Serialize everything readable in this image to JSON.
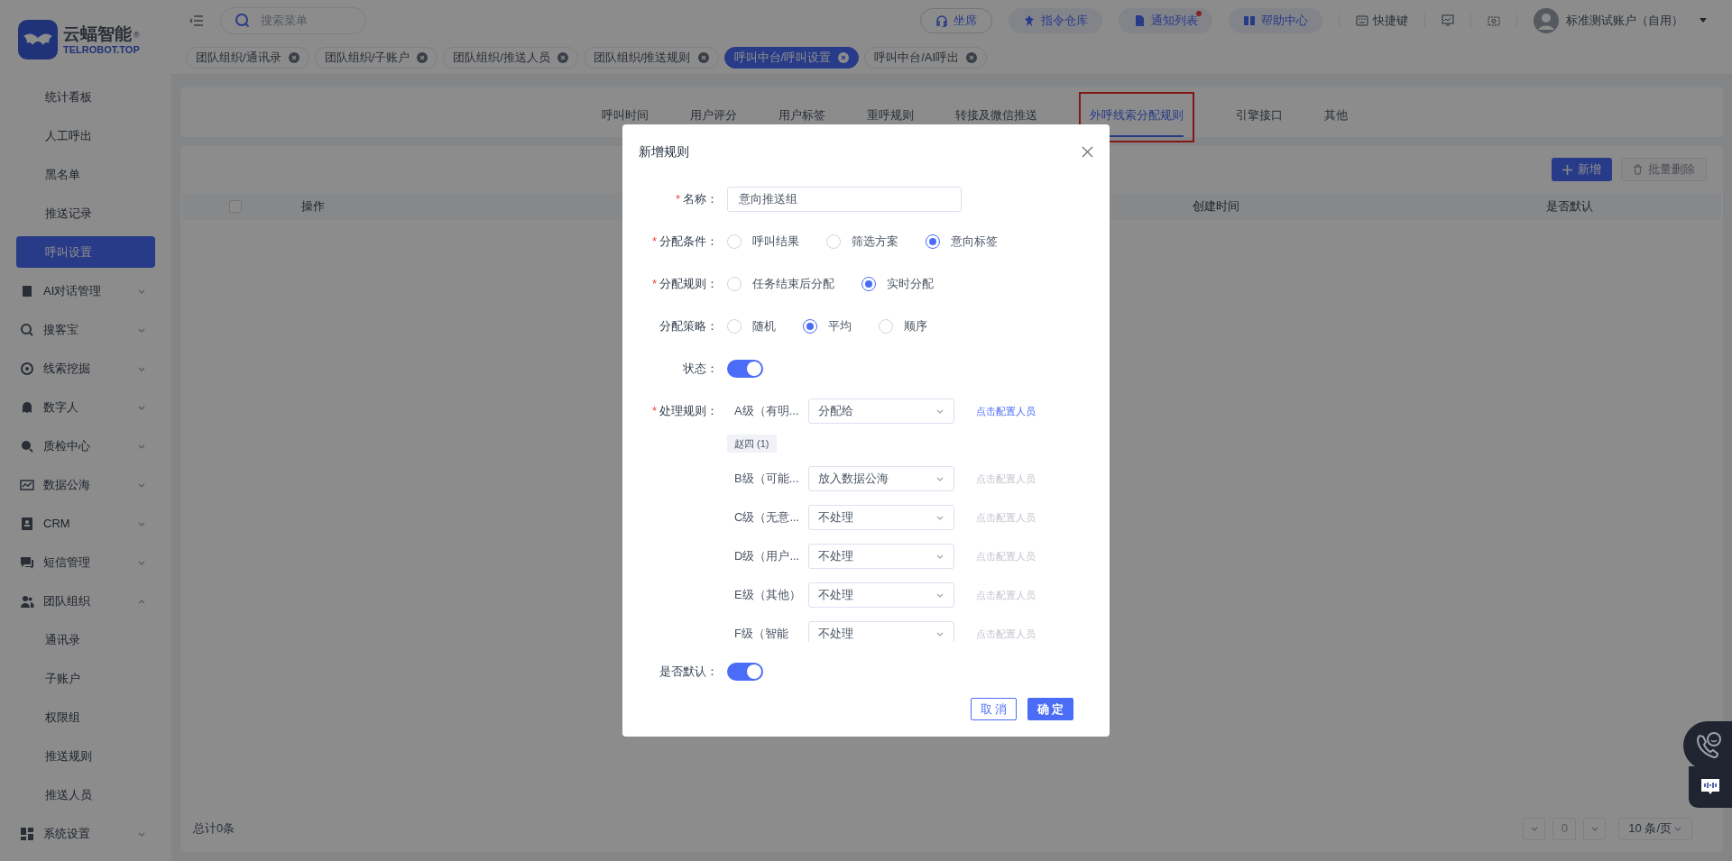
{
  "sidebar": {
    "logo": {
      "name": "云蝠智能",
      "sub": "TELROBOT.TOP",
      "mark": "®"
    },
    "items": [
      {
        "kind": "link",
        "label": "统计看板",
        "selected": false
      },
      {
        "kind": "link",
        "label": "人工呼出",
        "selected": false
      },
      {
        "kind": "link",
        "label": "黑名单",
        "selected": false
      },
      {
        "kind": "link",
        "label": "推送记录",
        "selected": false
      },
      {
        "kind": "link",
        "label": "呼叫设置",
        "selected": true
      },
      {
        "kind": "group",
        "label": "AI对话管理",
        "expanded": false
      },
      {
        "kind": "group",
        "label": "搜客宝",
        "expanded": false
      },
      {
        "kind": "group",
        "label": "线索挖掘",
        "expanded": false
      },
      {
        "kind": "group",
        "label": "数字人",
        "expanded": false
      },
      {
        "kind": "group",
        "label": "质检中心",
        "expanded": false
      },
      {
        "kind": "group",
        "label": "数据公海",
        "expanded": false
      },
      {
        "kind": "group",
        "label": "CRM",
        "expanded": false
      },
      {
        "kind": "group",
        "label": "短信管理",
        "expanded": false
      },
      {
        "kind": "group",
        "label": "团队组织",
        "expanded": true,
        "children": [
          {
            "label": "通讯录",
            "selected": false
          },
          {
            "label": "子账户",
            "selected": false
          },
          {
            "label": "权限组",
            "selected": false
          },
          {
            "label": "推送规则",
            "selected": false
          },
          {
            "label": "推送人员",
            "selected": false
          }
        ]
      },
      {
        "kind": "group",
        "label": "系统设置",
        "expanded": false
      }
    ]
  },
  "header": {
    "search": {
      "placeholder": "搜索菜单"
    },
    "buttons": [
      {
        "kind": "outline",
        "label": "坐席",
        "dot": false
      },
      {
        "kind": "pill",
        "label": "指令仓库",
        "dot": false
      },
      {
        "kind": "pill",
        "label": "通知列表",
        "dot": true
      },
      {
        "kind": "pill",
        "label": "帮助中心",
        "dot": false
      }
    ],
    "shortcut": "快捷键",
    "user": "标准测试账户（自用）"
  },
  "tags": [
    {
      "label": "团队组织/通讯录",
      "selected": false
    },
    {
      "label": "团队组织/子账户",
      "selected": false
    },
    {
      "label": "团队组织/推送人员",
      "selected": false
    },
    {
      "label": "团队组织/推送规则",
      "selected": false
    },
    {
      "label": "呼叫中台/呼叫设置",
      "selected": true
    },
    {
      "label": "呼叫中台/AI呼出",
      "selected": false
    }
  ],
  "tabs": [
    {
      "label": "呼叫时间",
      "selected": false,
      "annotated": false
    },
    {
      "label": "用户评分",
      "selected": false,
      "annotated": false
    },
    {
      "label": "用户标签",
      "selected": false,
      "annotated": false
    },
    {
      "label": "重呼规则",
      "selected": false,
      "annotated": false
    },
    {
      "label": "转接及微信推送",
      "selected": false,
      "annotated": false
    },
    {
      "label": "外呼线索分配规则",
      "selected": true,
      "annotated": true
    },
    {
      "label": "引擎接口",
      "selected": false,
      "annotated": false
    },
    {
      "label": "其他",
      "selected": false,
      "annotated": false
    }
  ],
  "toolbar": [
    {
      "label": "新增",
      "disabled": false
    },
    {
      "label": "批量删除",
      "disabled": true
    }
  ],
  "table": {
    "select_all": {
      "checked": false
    },
    "columns": [
      "操作",
      "创建时间",
      "是否默认"
    ]
  },
  "footer": {
    "total": "总计0条",
    "page": "0",
    "page_size": "10 条/页"
  },
  "modal": {
    "title": "新增规则",
    "fields": [
      {
        "kind": "text",
        "label": "名称：",
        "required_mark": "*",
        "value": "意向推送组"
      },
      {
        "kind": "radio",
        "label": "分配条件：",
        "required_mark": "*",
        "options": [
          {
            "label": "呼叫结果",
            "selected": false
          },
          {
            "label": "筛选方案",
            "selected": false
          },
          {
            "label": "意向标签",
            "selected": true
          }
        ]
      },
      {
        "kind": "radio",
        "label": "分配规则：",
        "required_mark": "*",
        "options": [
          {
            "label": "任务结束后分配",
            "selected": false
          },
          {
            "label": "实时分配",
            "selected": true
          }
        ]
      },
      {
        "kind": "radio",
        "label": "分配策略：",
        "options": [
          {
            "label": "随机",
            "selected": false
          },
          {
            "label": "平均",
            "selected": true
          },
          {
            "label": "顺序",
            "selected": false
          }
        ]
      },
      {
        "kind": "switch",
        "label": "状态：",
        "on": true
      },
      {
        "kind": "rules",
        "label": "处理规则：",
        "required_mark": "*",
        "rows": [
          {
            "level": "A级（有明...",
            "action": "分配给",
            "link": "点击配置人员",
            "disabled": false,
            "assignees": [
              "赵四 (1)"
            ]
          },
          {
            "level": "B级（可能...",
            "action": "放入数据公海",
            "link": "点击配置人员",
            "disabled": true
          },
          {
            "level": "C级（无意...",
            "action": "不处理",
            "link": "点击配置人员",
            "disabled": true
          },
          {
            "level": "D级（用户...",
            "action": "不处理",
            "link": "点击配置人员",
            "disabled": true
          },
          {
            "level": "E级（其他）",
            "action": "不处理",
            "link": "点击配置人员",
            "disabled": true
          },
          {
            "level": "F级（智能",
            "action": "不处理",
            "link": "点击配置人员",
            "disabled": true
          }
        ]
      },
      {
        "kind": "switch",
        "label": "是否默认：",
        "on": true
      }
    ],
    "buttons": [
      {
        "kind": "cancel",
        "label": "取 消"
      },
      {
        "kind": "confirm",
        "label": "确 定"
      }
    ]
  }
}
